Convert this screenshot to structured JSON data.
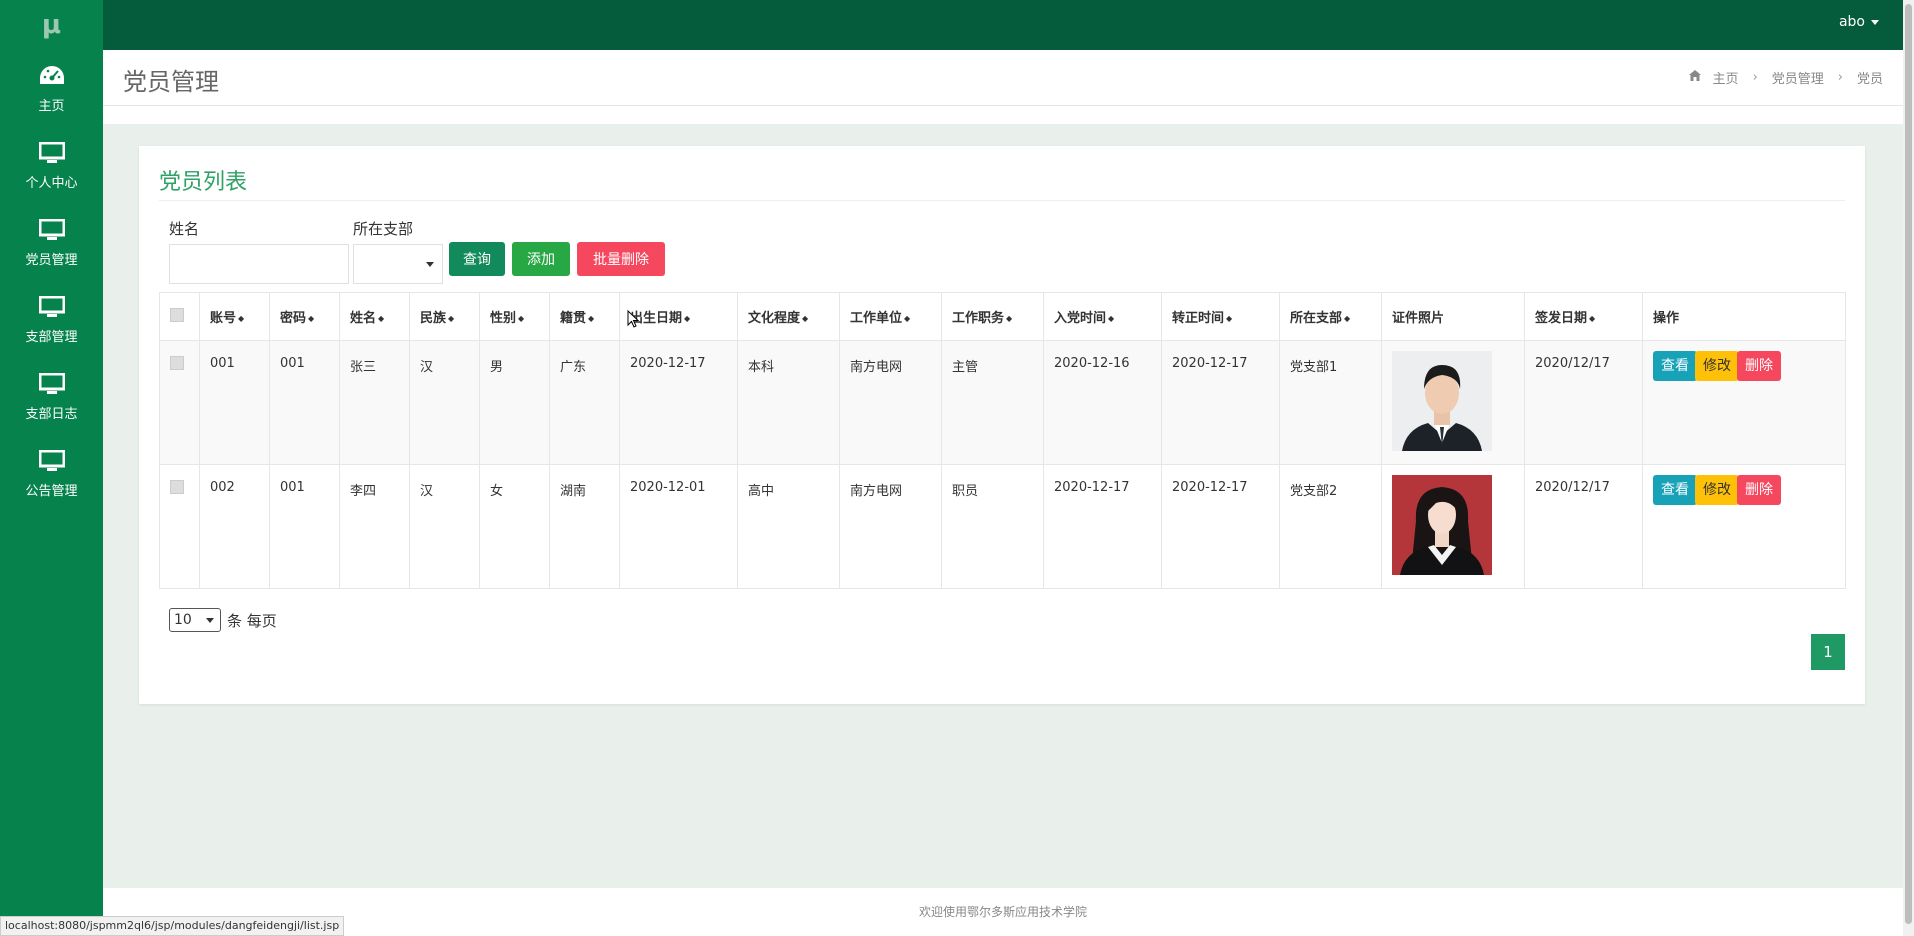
{
  "app": {
    "logo": "μ"
  },
  "sidebar": {
    "items": [
      {
        "label": "主页",
        "icon": "dashboard-icon"
      },
      {
        "label": "个人中心",
        "icon": "monitor-icon"
      },
      {
        "label": "党员管理",
        "icon": "monitor-icon"
      },
      {
        "label": "支部管理",
        "icon": "monitor-icon"
      },
      {
        "label": "支部日志",
        "icon": "monitor-icon"
      },
      {
        "label": "公告管理",
        "icon": "monitor-icon"
      }
    ]
  },
  "topbar": {
    "user": "abo"
  },
  "header": {
    "title": "党员管理",
    "breadcrumb": [
      "主页",
      "党员管理",
      "党员"
    ]
  },
  "card": {
    "title": "党员列表"
  },
  "search": {
    "name_label": "姓名",
    "branch_label": "所在支部",
    "query_label": "查询",
    "add_label": "添加",
    "batch_delete_label": "批量删除"
  },
  "table": {
    "headers": [
      "账号",
      "密码",
      "姓名",
      "民族",
      "性别",
      "籍贯",
      "出生日期",
      "文化程度",
      "工作单位",
      "工作职务",
      "入党时间",
      "转正时间",
      "所在支部",
      "证件照片",
      "签发日期",
      "操作"
    ],
    "rows": [
      {
        "account": "001",
        "password": "001",
        "name": "张三",
        "ethnicity": "汉",
        "gender": "男",
        "origin": "广东",
        "birth": "2020-12-17",
        "education": "本科",
        "unit": "南方电网",
        "position": "主管",
        "join_date": "2020-12-16",
        "confirm_date": "2020-12-17",
        "branch": "党支部1",
        "issue_date": "2020/12/17"
      },
      {
        "account": "002",
        "password": "001",
        "name": "李四",
        "ethnicity": "汉",
        "gender": "女",
        "origin": "湖南",
        "birth": "2020-12-01",
        "education": "高中",
        "unit": "南方电网",
        "position": "职员",
        "join_date": "2020-12-17",
        "confirm_date": "2020-12-17",
        "branch": "党支部2",
        "issue_date": "2020/12/17"
      }
    ],
    "actions": {
      "view": "查看",
      "edit": "修改",
      "delete": "删除"
    }
  },
  "pagination": {
    "page_size": "10",
    "per_page_label": "条 每页",
    "current_page": "1"
  },
  "footer": {
    "text": "欢迎使用鄂尔多斯应用技术学院"
  },
  "status_url": "localhost:8080/jspmm2ql6/jsp/modules/dangfeidengji/list.jsp",
  "colors": {
    "sidebar": "#06824d",
    "topbar": "#045c3c",
    "view": "#17a2b8",
    "edit": "#ffc107",
    "delete": "#f5475e",
    "query": "#138a5b",
    "add": "#28a745",
    "accent": "#2fa266"
  }
}
